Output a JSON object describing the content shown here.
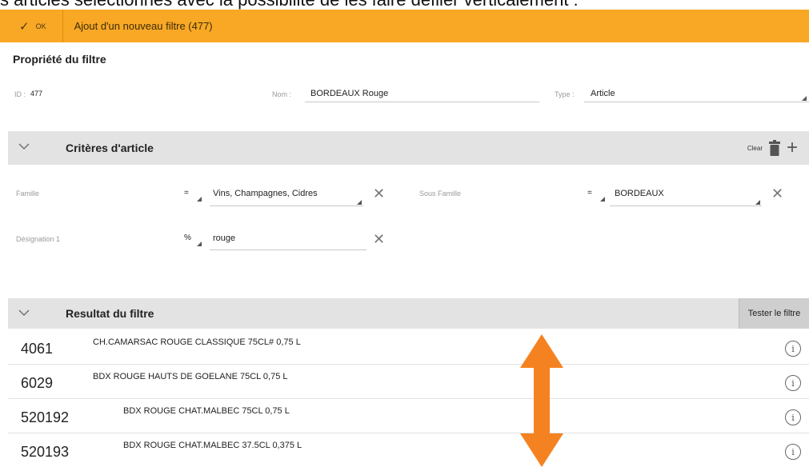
{
  "caption": "s articles sélectionnés avec la possibilité de les faire défiler verticalement :",
  "toolbar": {
    "ok_label": "OK",
    "title": "Ajout d'un nouveau filtre (477)",
    "accent": "#f9a825"
  },
  "properties": {
    "title": "Propriété du filtre",
    "id_label": "ID :",
    "id_value": "477",
    "nom_label": "Nom :",
    "nom_value": "BORDEAUX Rouge",
    "type_label": "Type :",
    "type_value": "Article"
  },
  "criteria": {
    "title": "Critères d'article",
    "clear_label": "Clear",
    "rows": [
      {
        "label": "Famille",
        "operator": "=",
        "value": "Vins, Champagnes, Cidres"
      },
      {
        "label": "Sous Famille",
        "operator": "=",
        "value": "BORDEAUX"
      },
      {
        "label": "Désignation 1",
        "operator": "%",
        "value": "rouge"
      }
    ]
  },
  "result": {
    "title": "Resultat du filtre",
    "test_button": "Tester le filtre",
    "items": [
      {
        "code": "4061",
        "desc": "CH.CAMARSAC ROUGE CLASSIQUE 75CL#   0,75 L"
      },
      {
        "code": "6029",
        "desc": "BDX ROUGE HAUTS DE GOELANE 75CL   0,75 L"
      },
      {
        "code": "520192",
        "desc": "BDX ROUGE CHAT.MALBEC 75CL   0,75 L"
      },
      {
        "code": "520193",
        "desc": "BDX ROUGE CHAT.MALBEC 37.5CL   0,375 L"
      }
    ]
  },
  "icons": {
    "ok": "check-icon",
    "collapse": "chevron-down-icon",
    "trash": "trash-icon",
    "add": "plus-icon",
    "remove": "close-icon",
    "info": "info-icon",
    "scroll": "double-arrow-vertical-icon"
  },
  "colors": {
    "arrow": "#f58220"
  }
}
